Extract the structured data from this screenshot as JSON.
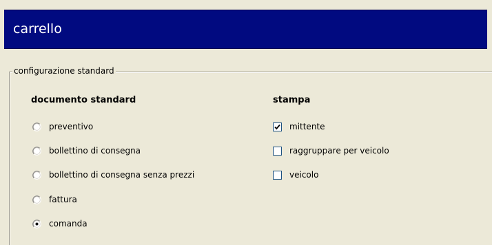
{
  "header": {
    "title": "carrello"
  },
  "group": {
    "legend": "configurazione standard",
    "document": {
      "title": "documento standard",
      "options": [
        {
          "label": "preventivo",
          "selected": false
        },
        {
          "label": "bollettino di consegna",
          "selected": false
        },
        {
          "label": "bollettino di consegna senza prezzi",
          "selected": false
        },
        {
          "label": "fattura",
          "selected": false
        },
        {
          "label": "comanda",
          "selected": true
        }
      ]
    },
    "print": {
      "title": "stampa",
      "options": [
        {
          "label": "mittente",
          "checked": true
        },
        {
          "label": "raggruppare per veicolo",
          "checked": false
        },
        {
          "label": "veicolo",
          "checked": false
        }
      ]
    }
  },
  "colors": {
    "header_background": "#010A80",
    "header_text": "#FFFFFF",
    "window_background": "#ECE9D8"
  }
}
